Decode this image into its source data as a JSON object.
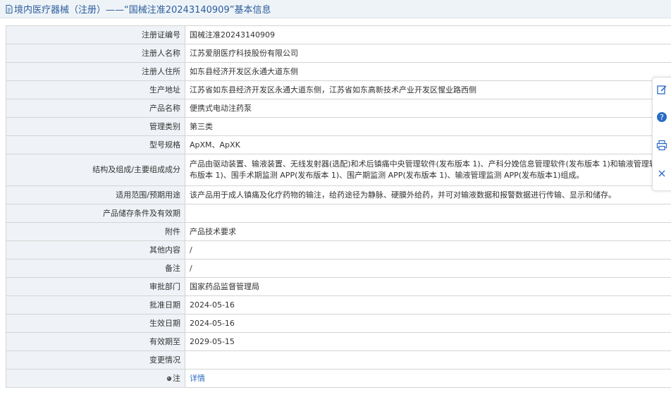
{
  "header": {
    "title": "境内医疗器械（注册）——“国械注准20243140909”基本信息",
    "icon": "document-icon",
    "color": "#2b5d9b"
  },
  "rows": [
    {
      "label": "注册证编号",
      "value": "国械注准20243140909"
    },
    {
      "label": "注册人名称",
      "value": "江苏爱朋医疗科技股份有限公司"
    },
    {
      "label": "注册人住所",
      "value": "如东县经济开发区永通大道东侧"
    },
    {
      "label": "生产地址",
      "value": "江苏省如东县经济开发区永通大道东侧，江苏省如东高新技术产业开发区惺业路西侧"
    },
    {
      "label": "产品名称",
      "value": "便携式电动注药泵"
    },
    {
      "label": "管理类别",
      "value": "第三类"
    },
    {
      "label": "型号规格",
      "value": "ApXM、ApXK"
    },
    {
      "label": "结构及组成/主要组成成分",
      "value": "产品由驱动装置、输液装置、无线发射器(选配)和术后镇痛中央管理软件(发布版本 1)、产科分娩信息管理软件(发布版本 1)和输液管理软件(发布版本 1)、围手术期监测 APP(发布版本 1)、围产期监测 APP(发布版本 1)、输液管理监测 APP(发布版本1)组成。"
    },
    {
      "label": "适用范围/预期用途",
      "value": "该产品用于成人镇痛及化疗药物的输注，给药途径为静脉、硬膜外给药，并可对输液数据和报警数据进行传输、显示和储存。"
    },
    {
      "label": "产品储存条件及有效期",
      "value": ""
    },
    {
      "label": "附件",
      "value": "产品技术要求"
    },
    {
      "label": "其他内容",
      "value": "/"
    },
    {
      "label": "备注",
      "value": "/"
    },
    {
      "label": "审批部门",
      "value": "国家药品监督管理局"
    },
    {
      "label": "批准日期",
      "value": "2024-05-16"
    },
    {
      "label": "生效日期",
      "value": "2024-05-16"
    },
    {
      "label": "有效期至",
      "value": "2029-05-15"
    },
    {
      "label": "变更情况",
      "value": ""
    }
  ],
  "note": {
    "label": "注",
    "link_text": "详情",
    "icon": "note-bullet-icon"
  },
  "toolbar": {
    "icons": [
      "edit-icon",
      "help-icon",
      "print-icon",
      "close-icon"
    ],
    "accent": "#2b6cc4"
  },
  "colors": {
    "label_bg": "#eff3f7",
    "border": "#d4d4d4",
    "header_bg": "#eef3f8",
    "link": "#2b6cc4"
  }
}
